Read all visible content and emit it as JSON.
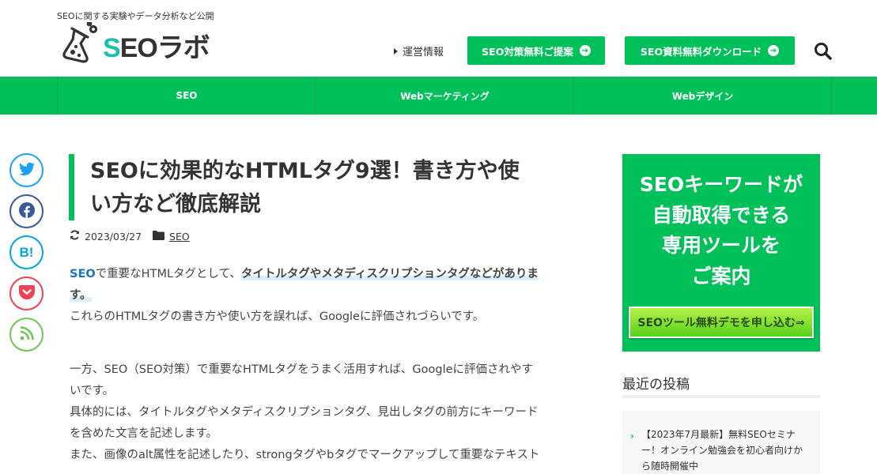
{
  "header": {
    "tagline": "SEOに関する実験やデータ分析など公開",
    "logo_text_s": "S",
    "logo_text_rest": "EOラボ",
    "nav_link": "運営情報",
    "btn_proposal": "SEO対策無料ご提案",
    "btn_download": "SEO資料無料ダウンロード",
    "search_icon": "search-icon",
    "accent": "#00c05a"
  },
  "gnav": {
    "items": [
      "SEO",
      "Webマーケティング",
      "Webデザイン"
    ]
  },
  "share": {
    "twitter": {
      "icon": "twitter-icon",
      "color": "#1da1f2"
    },
    "facebook": {
      "icon": "facebook-icon",
      "color": "#3b5998"
    },
    "hatena": {
      "label": "B!",
      "color": "#00a4de"
    },
    "pocket": {
      "icon": "pocket-icon",
      "color": "#ef4056"
    },
    "feed": {
      "icon": "rss-icon",
      "color": "#6cc655"
    }
  },
  "article": {
    "title_line1": "SEOに効果的なHTMLタグ9選！書き方や使",
    "title_line2": "い方など徹底解説",
    "date": "2023/03/27",
    "category": "SEO",
    "p1_link": "SEO",
    "p1_text": "で重要なHTMLタグとして、",
    "p1_highlight_a": "タイトルタグやメタディスクリプションタグなどがありま",
    "p1_highlight_b": "す。",
    "p2": "これらのHTMLタグの書き方や使い方を誤れば、Googleに評価されづらいです。",
    "p3_line1": "一方、SEO（SEO対策）で重要なHTMLタグをうまく活用すれば、Googleに評価されやす",
    "p3_line2": "いです。",
    "p4_line1": "具体的には、タイトルタグやメタディスクリプションタグ、見出しタグの前方にキーワード",
    "p4_line2": "を含めた文言を記述します。",
    "p5_line1": "また、画像のalt属性を記述したり、strongタグやbタグでマークアップして重要なテキスト"
  },
  "sidebar": {
    "banner_lines": [
      "SEOキーワードが",
      "自動取得できる",
      "専用ツールを",
      "ご案内"
    ],
    "banner_button": "SEOツール無料デモを申し込む⇒",
    "recent_heading": "最近の投稿",
    "recent_items": [
      {
        "text": "【2023年7月最新】無料SEOセミナー！オンライン勉強会を初心者向けから随時開催中"
      }
    ]
  }
}
